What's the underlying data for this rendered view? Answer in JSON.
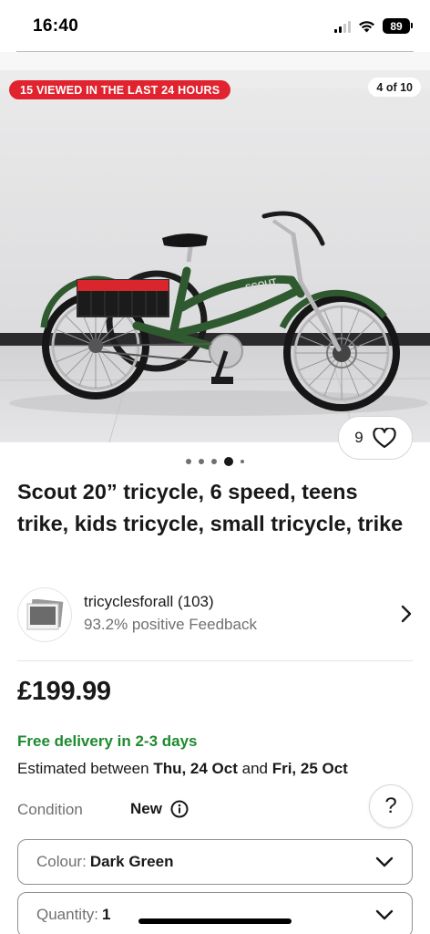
{
  "status_bar": {
    "time": "16:40",
    "battery": "89",
    "signal_bars_active": 2,
    "signal_bars_total": 4
  },
  "gallery": {
    "viewed_badge": "15 VIEWED IN THE LAST 24 HOURS",
    "image_counter": "4 of 10",
    "watch_count": "9",
    "dots_total": 5,
    "dots_active_index": 3,
    "photo_icon": "tricycle-photo",
    "colors": {
      "badge": "#e0232e",
      "frame": "#2f5a2f",
      "basket": "#d8262c"
    }
  },
  "listing": {
    "title": "Scout 20” tricycle, 6 speed, teens trike, kids tricycle, small tricycle, trike",
    "price": "£199.99"
  },
  "seller": {
    "name": "tricyclesforall (103)",
    "feedback": "93.2% positive Feedback",
    "avatar_icon": "seller-photo-icon"
  },
  "delivery": {
    "headline": "Free delivery in 2-3 days",
    "estimate_prefix": "Estimated between ",
    "estimate_from": "Thu, 24 Oct",
    "estimate_mid": " and ",
    "estimate_to": "Fri, 25 Oct",
    "color": "#1e8a2f"
  },
  "condition": {
    "label": "Condition",
    "value": "New",
    "info_icon": "info-icon",
    "help_label": "?"
  },
  "options": {
    "colour_label": "Colour:",
    "colour_value": "Dark Green",
    "quantity_label": "Quantity:",
    "quantity_value": "1"
  }
}
